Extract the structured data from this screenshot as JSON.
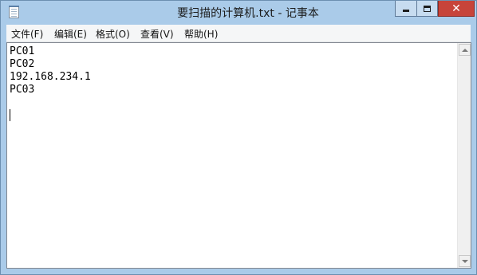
{
  "window": {
    "title": "要扫描的计算机.txt - 记事本",
    "controls": {
      "minimize_icon": "minimize-icon",
      "maximize_icon": "maximize-icon",
      "close_label": "✕"
    }
  },
  "menu": {
    "items": [
      {
        "label": "文件(F)"
      },
      {
        "label": "编辑(E)"
      },
      {
        "label": "格式(O)"
      },
      {
        "label": "查看(V)"
      },
      {
        "label": "帮助(H)"
      }
    ]
  },
  "document": {
    "lines": [
      "PC01",
      "PC02",
      "192.168.234.1",
      "PC03",
      ""
    ]
  },
  "colors": {
    "titlebar": "#aacbe9",
    "close_button": "#c7443a",
    "menubar": "#f5f6f7"
  }
}
